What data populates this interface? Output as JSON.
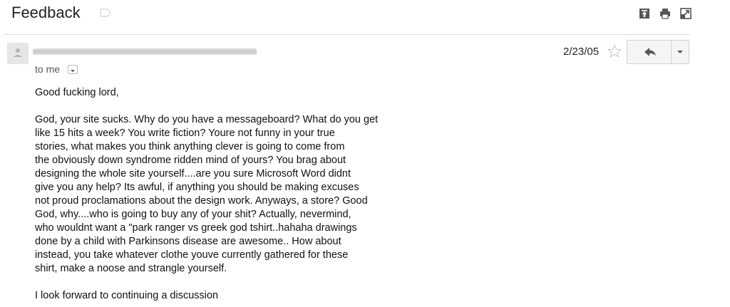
{
  "header": {
    "subject": "Feedback",
    "icons": [
      "label-tag-icon",
      "collapse-icon",
      "print-icon",
      "new-window-icon"
    ]
  },
  "message": {
    "date": "2/23/05",
    "recipient": "to me",
    "icons": [
      "avatar-icon",
      "star-icon",
      "reply-icon",
      "dropdown-icon"
    ],
    "body": {
      "greeting": "Good fucking lord,",
      "lines": [
        "God, your site sucks. Why do you have a messageboard? What do you get",
        "like 15 hits a week? You write fiction? Youre not funny in your true",
        "stories, what makes you think anything clever is going to come from",
        "the obviously down syndrome ridden mind of yours? You brag about",
        "designing the whole site yourself....are you sure Microsoft Word didnt",
        "give you any help? Its awful, if anything you should be making excuses",
        "not proud proclamations about the design work. Anyways, a store? Good",
        "God, why....who is going to buy any of your shit? Actually, nevermind,",
        "who wouldnt want a \"park ranger vs greek god tshirt..hahaha drawings",
        "done by a child with Parkinsons disease are awesome.. How about",
        "instead, you take whatever clothe youve currently gathered for these",
        "shirt, make a noose and strangle yourself."
      ],
      "closing": "I look forward to continuing a discussion"
    }
  }
}
